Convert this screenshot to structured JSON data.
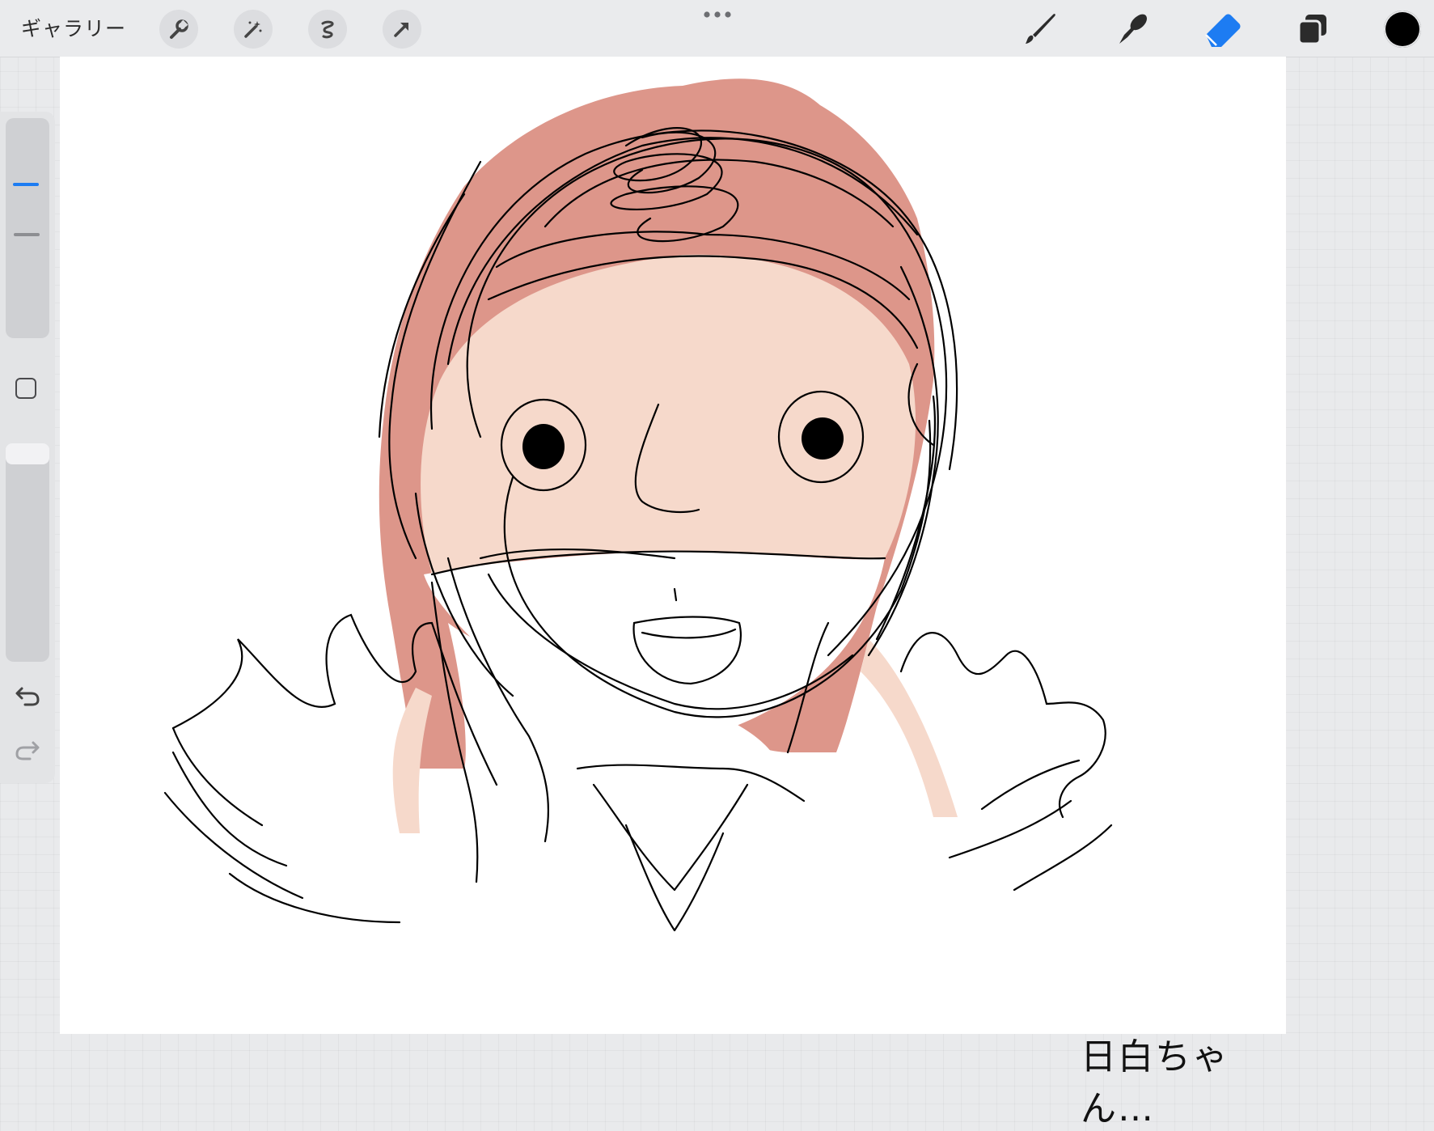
{
  "toolbar": {
    "gallery_label": "ギャラリー",
    "left_tools": [
      "wrench-icon",
      "magic-wand-icon",
      "selection-icon",
      "transform-arrow-icon"
    ],
    "right_tools": [
      "brush-icon",
      "smudge-icon",
      "eraser-icon",
      "layers-icon"
    ],
    "active_tool": "eraser-icon",
    "active_color": "#000000",
    "accent_color": "#1d7cf2"
  },
  "sidebar": {
    "controls": [
      "brush-size-slider",
      "modify-button",
      "opacity-slider",
      "undo-icon",
      "redo-icon"
    ]
  },
  "canvas": {
    "handwritten_text": "日白ちゃん…",
    "colors": {
      "hair": "#dd968a",
      "skin": "#f6d9cb",
      "line": "#000000"
    }
  }
}
